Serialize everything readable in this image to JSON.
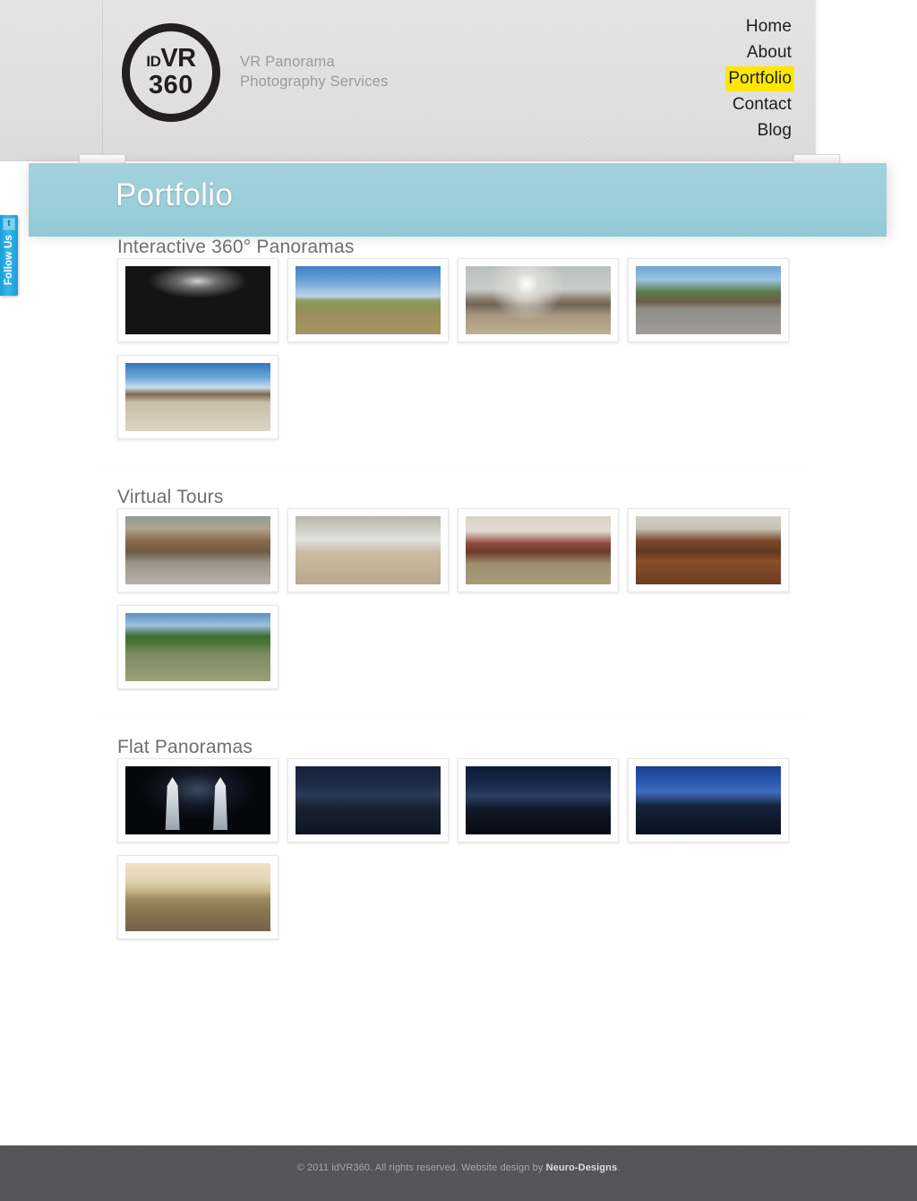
{
  "site": {
    "logo": {
      "id_text": "ID",
      "vr_text": "VR",
      "num_text": "360",
      "tagline_line1": "VR Panorama",
      "tagline_line2": "Photography Services"
    },
    "accent_yellow": "#ffe800",
    "banner_blue": "#9ccedb",
    "footer_gray": "#555456",
    "follow_blue": "#1b9fd8"
  },
  "nav": {
    "items": [
      {
        "label": "Home",
        "active": false
      },
      {
        "label": "About",
        "active": false
      },
      {
        "label": "Portfolio",
        "active": true
      },
      {
        "label": "Contact",
        "active": false
      },
      {
        "label": "Blog",
        "active": false
      }
    ]
  },
  "banner": {
    "title": "Portfolio"
  },
  "follow": {
    "label": "Follow Us",
    "icon": "twitter-icon",
    "icon_glyph": "t"
  },
  "sections": [
    {
      "title": "Interactive 360° Panoramas",
      "thumbs": [
        {
          "alt": "Black and white cave little-planet panorama",
          "art": "img-cave"
        },
        {
          "alt": "Thatched village huts equirectangular panorama",
          "art": "img-huts"
        },
        {
          "alt": "Volcano crater equirectangular panorama",
          "art": "img-volcano"
        },
        {
          "alt": "Beach bar with bicycles little-planet panorama",
          "art": "img-beachbar"
        },
        {
          "alt": "Tropical beach hut little-planet panorama",
          "art": "img-beach"
        }
      ]
    },
    {
      "title": "Virtual Tours",
      "thumbs": [
        {
          "alt": "Shopping mall interior virtual tour",
          "art": "img-lobby"
        },
        {
          "alt": "Restaurant dining hall virtual tour",
          "art": "img-restaurant"
        },
        {
          "alt": "Hotel suite living room virtual tour",
          "art": "img-suite"
        },
        {
          "alt": "Wine shop interior virtual tour",
          "art": "img-wineshop"
        },
        {
          "alt": "Resort driveway with palm trees virtual tour",
          "art": "img-resort"
        }
      ]
    },
    {
      "title": "Flat Panoramas",
      "thumbs": [
        {
          "alt": "Petronas Twin Towers at night",
          "art": "img-towers"
        },
        {
          "alt": "City skyline at night with lit towers",
          "art": "img-city-night1"
        },
        {
          "alt": "City skyline at dusk panorama",
          "art": "img-city-night2"
        },
        {
          "alt": "Blue hour city aerial panorama",
          "art": "img-city-blue"
        },
        {
          "alt": "Sepia toned city square panorama",
          "art": "img-sepia"
        }
      ]
    }
  ],
  "footer": {
    "text_before": "© 2011 idVR360. All rights reserved. Website design by ",
    "credit": "Neuro-Designs",
    "text_after": "."
  }
}
